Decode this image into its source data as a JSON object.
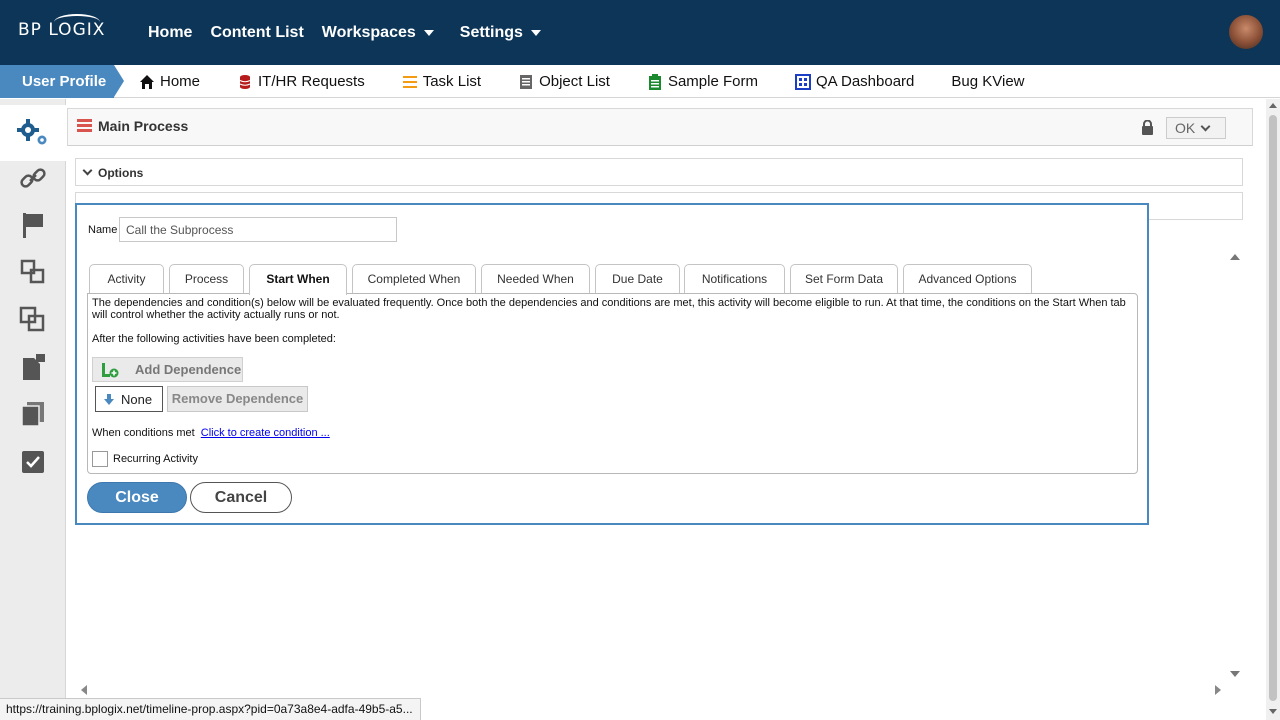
{
  "header": {
    "logo_text": "BP LOGIX",
    "nav": [
      "Home",
      "Content List",
      "Workspaces",
      "Settings"
    ]
  },
  "subnav": {
    "active": "User Profile",
    "items": [
      {
        "label": "Home",
        "icon": "home-icon"
      },
      {
        "label": "IT/HR Requests",
        "icon": "database-icon"
      },
      {
        "label": "Task List",
        "icon": "list-icon"
      },
      {
        "label": "Object List",
        "icon": "document-icon"
      },
      {
        "label": "Sample Form",
        "icon": "form-icon"
      },
      {
        "label": "QA Dashboard",
        "icon": "dashboard-icon"
      },
      {
        "label": "Bug KView",
        "icon": ""
      }
    ]
  },
  "process": {
    "title": "Main Process",
    "ok_label": "OK",
    "options_label": "Options"
  },
  "dialog": {
    "name_label": "Name",
    "name_value": "Call the Subprocess",
    "tabs": [
      "Activity",
      "Process",
      "Start When",
      "Completed When",
      "Needed When",
      "Due Date",
      "Notifications",
      "Set Form Data",
      "Advanced Options"
    ],
    "active_tab": "Start When",
    "description": "The dependencies and condition(s) below will be evaluated frequently. Once both the dependencies and conditions are met, this activity will become eligible to run. At that time, the conditions on the Start When tab will control whether the activity actually runs or not.",
    "after_text": "After the following activities have been completed:",
    "add_dependence": "Add Dependence",
    "dependence_value": "None",
    "remove_dependence": "Remove Dependence",
    "conditions_label": "When conditions met",
    "conditions_link": "Click to create condition ...",
    "recurring_label": "Recurring Activity",
    "recurring_checked": false,
    "close_label": "Close",
    "cancel_label": "Cancel"
  },
  "status_url": "https://training.bplogix.net/timeline-prop.aspx?pid=0a73a8e4-adfa-49b5-a5...",
  "colors": {
    "header_bg": "#0c3557",
    "accent": "#4a89c0"
  }
}
